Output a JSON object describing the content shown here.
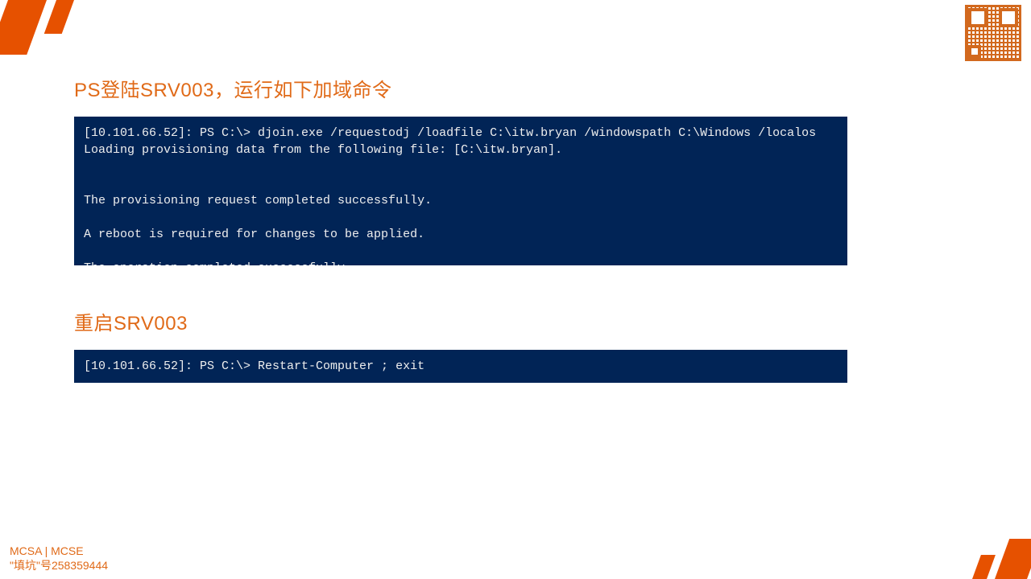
{
  "heading1": "PS登陆SRV003，运行如下加域命令",
  "terminal1": "[10.101.66.52]: PS C:\\> djoin.exe /requestodj /loadfile C:\\itw.bryan /windowspath C:\\Windows /localos\nLoading provisioning data from the following file: [C:\\itw.bryan].\n\n\nThe provisioning request completed successfully.\n\nA reboot is required for changes to be applied.\n\nThe operation completed successfully.",
  "heading2": "重启SRV003",
  "terminal2": "[10.101.66.52]: PS C:\\> Restart-Computer ; exit",
  "footer_line1": "MCSA | MCSE",
  "footer_line2": "\"填坑\"号258359444"
}
